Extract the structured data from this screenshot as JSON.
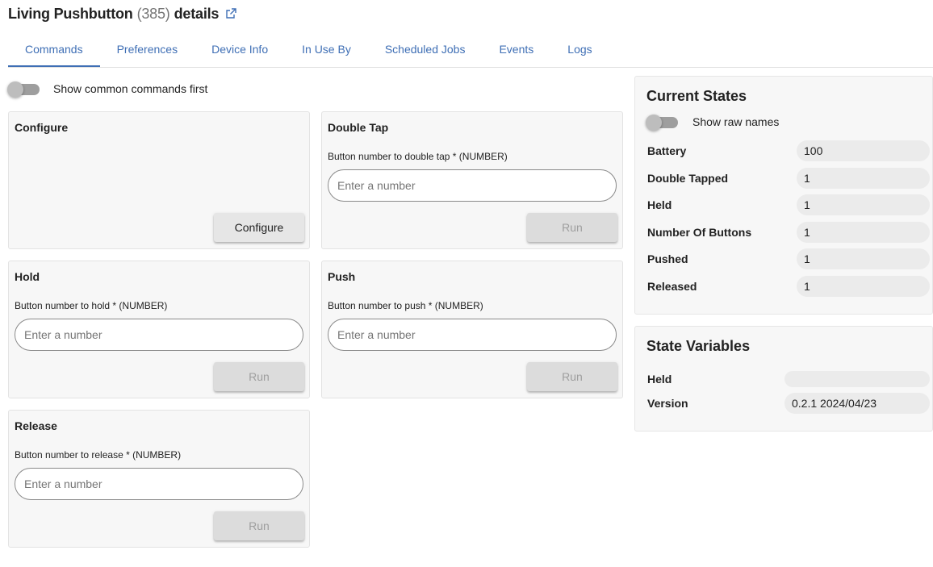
{
  "header": {
    "device_name": "Living Pushbutton",
    "device_id": "(385)",
    "suffix": "details"
  },
  "tabs": [
    {
      "label": "Commands",
      "active": true
    },
    {
      "label": "Preferences"
    },
    {
      "label": "Device Info"
    },
    {
      "label": "In Use By"
    },
    {
      "label": "Scheduled Jobs"
    },
    {
      "label": "Events"
    },
    {
      "label": "Logs"
    }
  ],
  "commands": {
    "toggle_label": "Show common commands first",
    "cards": [
      {
        "title": "Configure",
        "button": "Configure"
      },
      {
        "title": "Double Tap",
        "field_label": "Button number to double tap * (NUMBER)",
        "placeholder": "Enter a number",
        "button": "Run"
      },
      {
        "title": "Hold",
        "field_label": "Button number to hold * (NUMBER)",
        "placeholder": "Enter a number",
        "button": "Run"
      },
      {
        "title": "Push",
        "field_label": "Button number to push * (NUMBER)",
        "placeholder": "Enter a number",
        "button": "Run"
      },
      {
        "title": "Release",
        "field_label": "Button number to release * (NUMBER)",
        "placeholder": "Enter a number",
        "button": "Run"
      }
    ]
  },
  "current_states": {
    "title": "Current States",
    "toggle_label": "Show raw names",
    "rows": [
      {
        "name": "Battery",
        "value": "100"
      },
      {
        "name": "Double Tapped",
        "value": "1"
      },
      {
        "name": "Held",
        "value": "1"
      },
      {
        "name": "Number Of Buttons",
        "value": "1"
      },
      {
        "name": "Pushed",
        "value": "1"
      },
      {
        "name": "Released",
        "value": "1"
      }
    ]
  },
  "state_variables": {
    "title": "State Variables",
    "rows": [
      {
        "name": "Held",
        "value": ""
      },
      {
        "name": "Version",
        "value": "0.2.1 2024/04/23"
      }
    ]
  },
  "colors": {
    "accent": "#3f6fb5",
    "card_bg": "#f7f7f7",
    "toggle_track": "#9e9e9e"
  },
  "icons": {
    "external_link": "external-link-icon"
  }
}
